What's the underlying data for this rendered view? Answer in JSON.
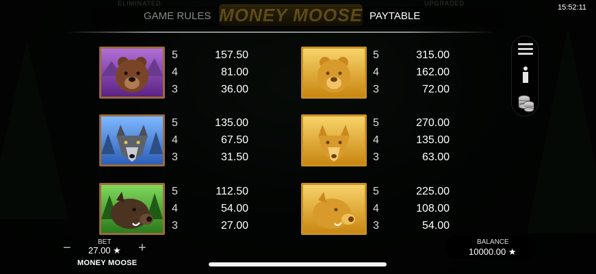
{
  "status": {
    "time": "15:52:11"
  },
  "header": {
    "logo_text": "MONEY MOOSE",
    "ghost_left": "ELIMINATED",
    "ghost_right": "UPGRADED",
    "tabs": [
      {
        "label": "GAME RULES",
        "active": false
      },
      {
        "label": "PAYTABLE",
        "active": true
      }
    ]
  },
  "side_menu": {
    "icons": [
      "menu-icon",
      "info-icon",
      "coins-icon"
    ]
  },
  "paytable": {
    "left": [
      {
        "symbol": "purple-bear-icon",
        "counts": [
          "5",
          "4",
          "3"
        ],
        "values": [
          "157.50",
          "81.00",
          "36.00"
        ]
      },
      {
        "symbol": "blue-wolf-icon",
        "counts": [
          "5",
          "4",
          "3"
        ],
        "values": [
          "135.00",
          "67.50",
          "31.50"
        ]
      },
      {
        "symbol": "green-boar-icon",
        "counts": [
          "5",
          "4",
          "3"
        ],
        "values": [
          "112.50",
          "54.00",
          "27.00"
        ]
      }
    ],
    "right": [
      {
        "symbol": "gold-bear-icon",
        "counts": [
          "5",
          "4",
          "3"
        ],
        "values": [
          "315.00",
          "162.00",
          "72.00"
        ]
      },
      {
        "symbol": "gold-wolf-icon",
        "counts": [
          "5",
          "4",
          "3"
        ],
        "values": [
          "270.00",
          "135.00",
          "63.00"
        ]
      },
      {
        "symbol": "gold-boar-icon",
        "counts": [
          "5",
          "4",
          "3"
        ],
        "values": [
          "225.00",
          "108.00",
          "54.00"
        ]
      }
    ]
  },
  "footer": {
    "minus": "−",
    "plus": "+",
    "bet_label": "BET",
    "bet_value": "27.00 ★",
    "game_name": "MONEY MOOSE",
    "balance_label": "BALANCE",
    "balance_value": "10000.00 ★"
  },
  "colors": {
    "frame_wood": "#9b6b3a",
    "frame_gold": "#c8911f",
    "purple_bg": "#7a3fa0",
    "blue_bg": "#3f7fd6",
    "green_bg": "#3d9a2c",
    "gold_bg": "#e0a51c"
  }
}
